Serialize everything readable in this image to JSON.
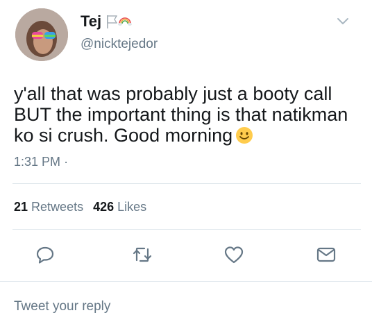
{
  "header": {
    "display_name": "Tej",
    "handle": "@nicktejedor"
  },
  "tweet": {
    "text": "y'all that was probably just a booty call BUT the important thing is that natikman ko si crush. Good morning",
    "time": "1:31 PM",
    "time_separator": "·"
  },
  "stats": {
    "retweets_count": "21",
    "retweets_label": "Retweets",
    "likes_count": "426",
    "likes_label": "Likes"
  },
  "actions": [
    "reply-icon",
    "retweet-icon",
    "like-icon",
    "direct-message-icon"
  ],
  "reply": {
    "placeholder": "Tweet your reply"
  },
  "colors": {
    "text": "#14171a",
    "muted": "#657786",
    "divider": "#e1e8ed"
  }
}
